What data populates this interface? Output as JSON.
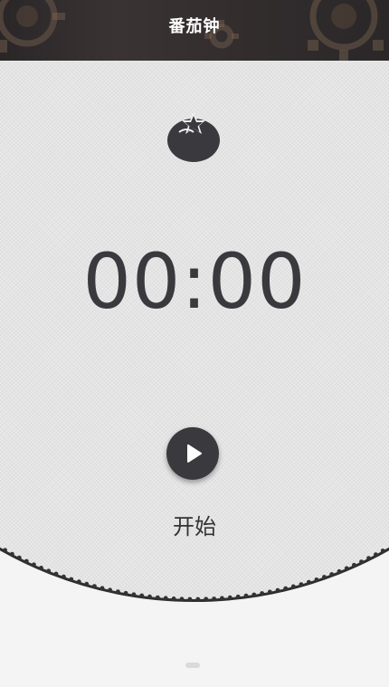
{
  "header": {
    "title": "番茄钟",
    "background_color": "#2f2a2b"
  },
  "timer": {
    "display": "00:00",
    "icon": "tomato-icon",
    "progress": 0
  },
  "controls": {
    "play_icon": "play-icon",
    "start_label": "开始"
  },
  "colors": {
    "accent": "#3a3a3e",
    "dial_border": "#2f2d2e",
    "background": "#f4f4f4"
  }
}
